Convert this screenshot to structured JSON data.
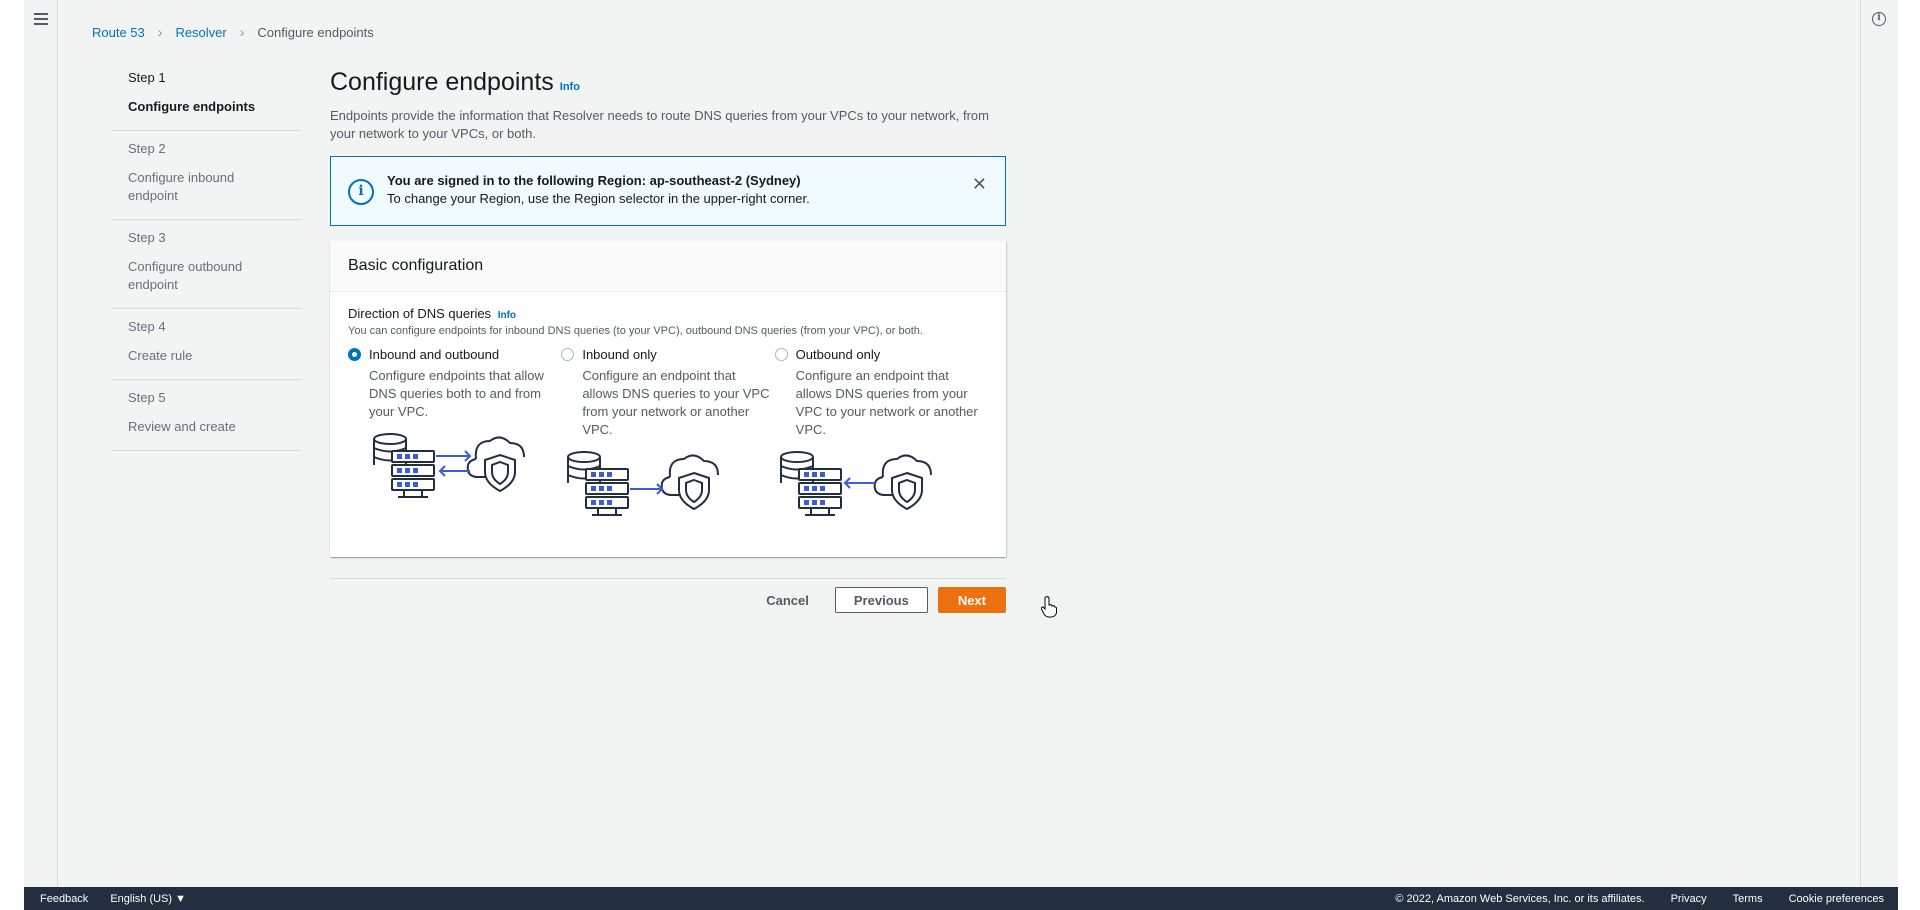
{
  "breadcrumb": {
    "items": [
      "Route 53",
      "Resolver"
    ],
    "current": "Configure endpoints"
  },
  "steps": [
    {
      "num": "Step 1",
      "title": "Configure endpoints"
    },
    {
      "num": "Step 2",
      "title": "Configure inbound endpoint"
    },
    {
      "num": "Step 3",
      "title": "Configure outbound endpoint"
    },
    {
      "num": "Step 4",
      "title": "Create rule"
    },
    {
      "num": "Step 5",
      "title": "Review and create"
    }
  ],
  "page": {
    "title": "Configure endpoints",
    "info": "Info",
    "description": "Endpoints provide the information that Resolver needs to route DNS queries from your VPCs to your network, from your network to your VPCs, or both."
  },
  "flash": {
    "title": "You are signed in to the following Region: ap-southeast-2 (Sydney)",
    "message": "To change your Region, use the Region selector in the upper-right corner."
  },
  "panel": {
    "header": "Basic configuration",
    "field_label": "Direction of DNS queries",
    "field_info": "Info",
    "field_hint": "You can configure endpoints for inbound DNS queries (to your VPC), outbound DNS queries (from your VPC), or both.",
    "options": [
      {
        "title": "Inbound and outbound",
        "desc": "Configure endpoints that allow DNS queries both to and from your VPC.",
        "selected": true
      },
      {
        "title": "Inbound only",
        "desc": "Configure an endpoint that allows DNS queries to your VPC from your network or another VPC.",
        "selected": false
      },
      {
        "title": "Outbound only",
        "desc": "Configure an endpoint that allows DNS queries from your VPC to your network or another VPC.",
        "selected": false
      }
    ]
  },
  "actions": {
    "cancel": "Cancel",
    "previous": "Previous",
    "next": "Next"
  },
  "footer": {
    "feedback": "Feedback",
    "language": "English (US) ▼",
    "copyright": "© 2022, Amazon Web Services, Inc. or its affiliates.",
    "privacy": "Privacy",
    "terms": "Terms",
    "cookies": "Cookie preferences"
  },
  "colors": {
    "accent": "#0073bb",
    "primary_button": "#ec7211",
    "footer_bg": "#232f3e",
    "illustration_arrow": "#3b5bdb"
  }
}
